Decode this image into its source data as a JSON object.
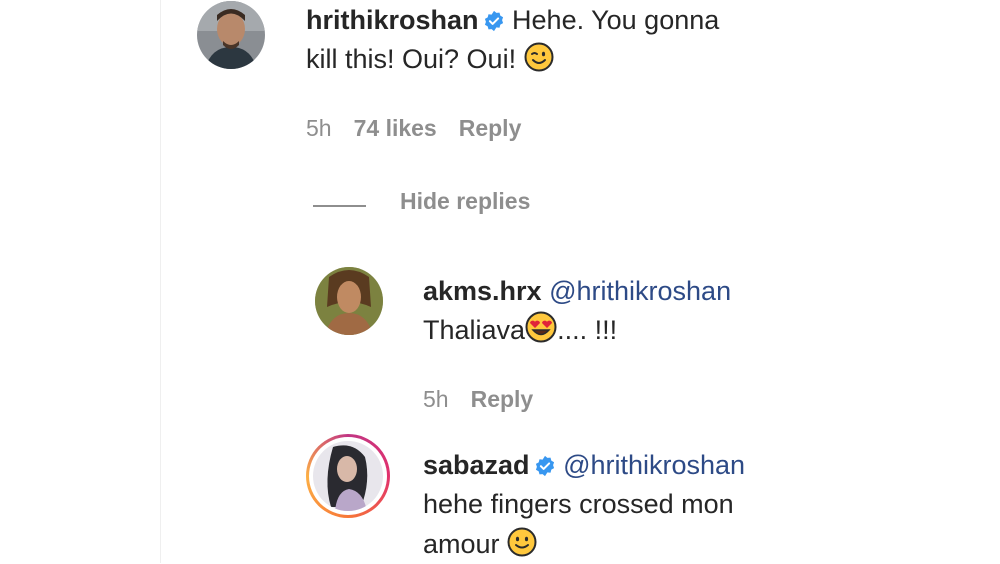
{
  "comments": [
    {
      "username": "hrithikroshan",
      "verified": true,
      "text_line1": "Hehe. You gonna",
      "text_line2": "kill this! Oui? Oui!",
      "emoji": "wink-emoji",
      "time": "5h",
      "likes": "74 likes",
      "reply": "Reply"
    }
  ],
  "hide_replies": "Hide replies",
  "replies": [
    {
      "username": "akms.hrx",
      "verified": false,
      "mention": "@hrithikroshan",
      "text": "Thaliava",
      "text_after": ".... !!!",
      "emoji": "heart-eyes-emoji",
      "time": "5h",
      "reply": "Reply"
    },
    {
      "username": "sabazad",
      "verified": true,
      "mention": "@hrithikroshan",
      "text_line1": "hehe fingers crossed mon",
      "text_line2": "amour",
      "emoji": "smile-emoji"
    }
  ],
  "colors": {
    "text": "#262626",
    "muted": "#8e8e8e",
    "mention": "#2d4a86",
    "verified": "#3897f0",
    "story_ring": "#c13584"
  }
}
